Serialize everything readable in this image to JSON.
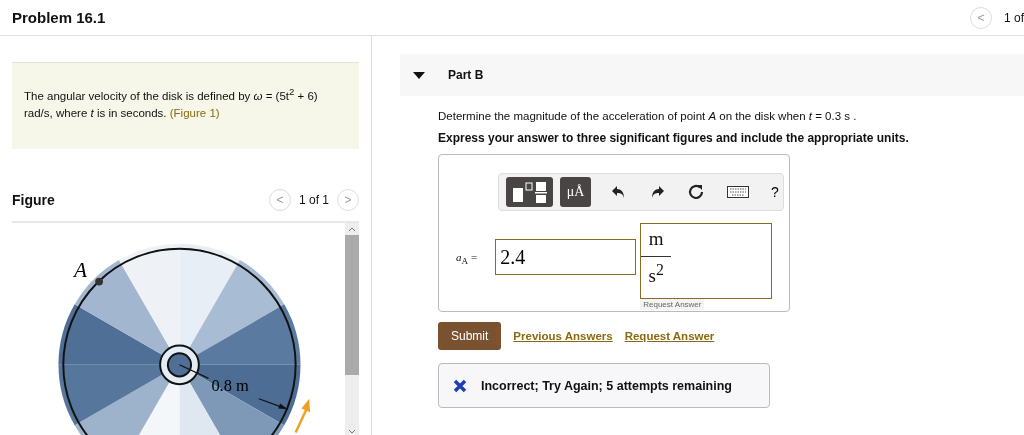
{
  "header": {
    "title": "Problem 16.1",
    "prev": "<",
    "counter": "1 of"
  },
  "problem": {
    "text": "The angular velocity of the disk is defined by *ω* = (5t$^{2}$ + 6) rad/s, where *t* is in seconds.",
    "link": "(Figure 1)"
  },
  "figure": {
    "title": "Figure",
    "prev": "<",
    "counter": "1 of 1",
    "next": ">",
    "point_label": "A",
    "radius_label": "0.8 m"
  },
  "part": {
    "title": "Part B",
    "expanded": true,
    "question": "Determine the magnitude of the acceleration of point *A* on the disk when *t* = 0.3 s .",
    "instruction": "Express your answer to three significant figures and include the appropriate units."
  },
  "toolbar": [
    {
      "kind": "templates"
    },
    {
      "kind": "units",
      "label": "μÅ"
    },
    {
      "kind": "undo"
    },
    {
      "kind": "redo"
    },
    {
      "kind": "reset"
    },
    {
      "kind": "keyboard"
    },
    {
      "kind": "help",
      "label": "?"
    }
  ],
  "answer": {
    "label": "*a*$_{A}$ =",
    "value": "2.4",
    "unit_numerator": "m",
    "unit_denominator": "s$^{2}$",
    "tooltip": "Request Answer"
  },
  "actions": {
    "submit": "Submit",
    "links": [
      "Previous Answers",
      "Request Answer"
    ]
  },
  "feedback": {
    "correct": false,
    "text": "Incorrect; Try Again; 5 attempts remaining"
  }
}
